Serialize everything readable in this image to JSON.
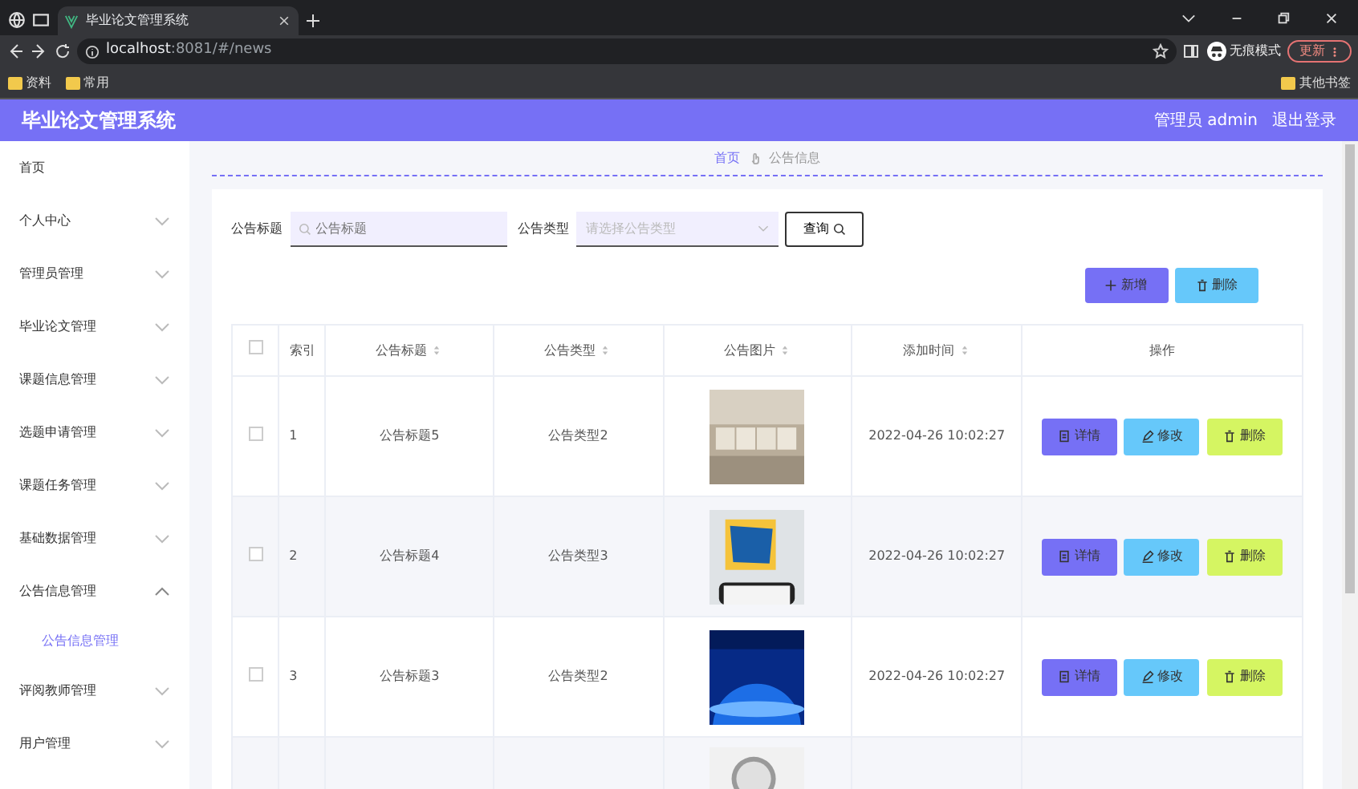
{
  "browser": {
    "tabs": [
      {
        "title": "毕业论文管理系统",
        "selected": true
      }
    ],
    "url": "**localhost**:8081/#/news",
    "profile": "无痕模式",
    "update_button": "更新",
    "bookmarks": [
      "资料",
      "常用"
    ],
    "other_bookmarks": "其他书签"
  },
  "header": {
    "title": "毕业论文管理系统",
    "user": "管理员 admin",
    "logout": "退出登录"
  },
  "sidebar": {
    "items": [
      {
        "label": "首页"
      },
      {
        "label": "个人中心",
        "expanded": false
      },
      {
        "label": "管理员管理",
        "expanded": false
      },
      {
        "label": "毕业论文管理",
        "expanded": false
      },
      {
        "label": "课题信息管理",
        "expanded": false
      },
      {
        "label": "选题申请管理",
        "expanded": false
      },
      {
        "label": "课题任务管理",
        "expanded": false
      },
      {
        "label": "基础数据管理",
        "expanded": false
      },
      {
        "label": "公告信息管理",
        "expanded": true,
        "children": [
          {
            "label": "公告信息管理",
            "selected": true
          }
        ]
      },
      {
        "label": "评阅教师管理",
        "expanded": false
      },
      {
        "label": "用户管理",
        "expanded": false
      }
    ]
  },
  "breadcrumb": [
    "首页",
    "公告信息"
  ],
  "filters": {
    "title_label": "公告标题",
    "title_placeholder": "公告标题",
    "type_label": "公告类型",
    "type_placeholder": "请选择公告类型",
    "search_button": "查询"
  },
  "toolbar": [
    "新增",
    "删除"
  ],
  "table": {
    "select_all": {
      "checked": false
    },
    "columns": [
      {
        "label": "索引",
        "sortable": false
      },
      {
        "label": "公告标题",
        "sortable": true
      },
      {
        "label": "公告类型",
        "sortable": true
      },
      {
        "label": "公告图片",
        "sortable": true
      },
      {
        "label": "添加时间",
        "sortable": true
      },
      {
        "label": "操作",
        "sortable": false
      }
    ],
    "rows": [
      {
        "checked": false,
        "index": "1",
        "title": "公告标题5",
        "type": "公告类型2",
        "time": "2022-04-26 10:02:27",
        "actions": [
          "详情",
          "修改",
          "删除"
        ]
      },
      {
        "checked": false,
        "index": "2",
        "title": "公告标题4",
        "type": "公告类型3",
        "time": "2022-04-26 10:02:27",
        "actions": [
          "详情",
          "修改",
          "删除"
        ]
      },
      {
        "checked": false,
        "index": "3",
        "title": "公告标题3",
        "type": "公告类型2",
        "time": "2022-04-26 10:02:27",
        "actions": [
          "详情",
          "修改",
          "删除"
        ]
      },
      {
        "kind": "partial"
      }
    ]
  }
}
